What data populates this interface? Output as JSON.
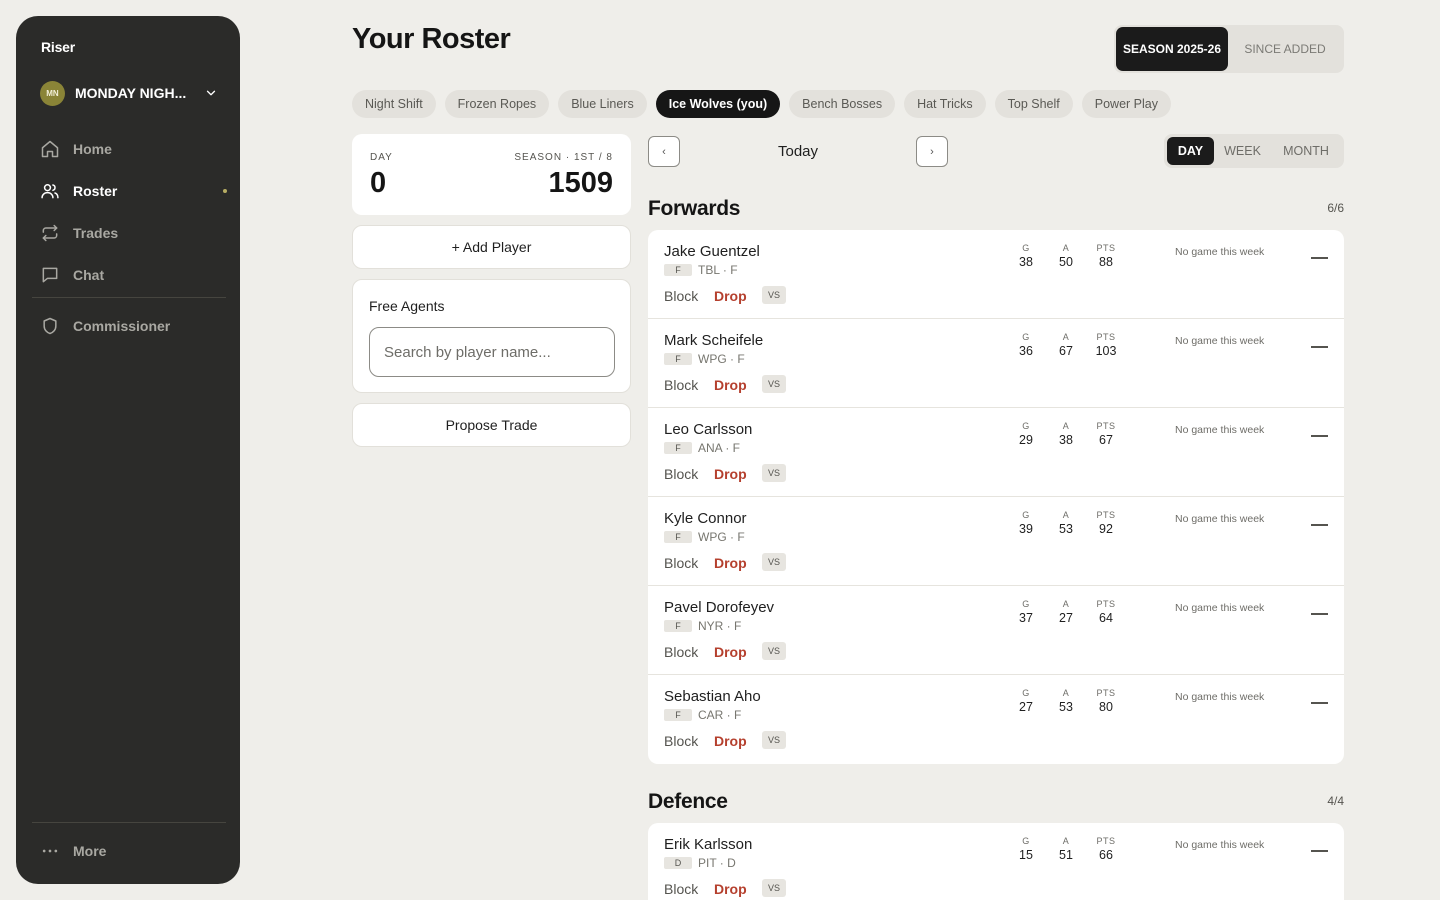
{
  "sidebar": {
    "brand": "Riser",
    "league": {
      "badge": "MN",
      "name": "MONDAY NIGH..."
    },
    "nav": [
      {
        "label": "Home",
        "icon": "home-icon",
        "active": false
      },
      {
        "label": "Roster",
        "icon": "users-icon",
        "active": true
      },
      {
        "label": "Trades",
        "icon": "swap-icon",
        "active": false
      },
      {
        "label": "Chat",
        "icon": "chat-icon",
        "active": false
      }
    ],
    "commissioner": {
      "label": "Commissioner",
      "icon": "shield-icon"
    },
    "more": {
      "label": "More",
      "icon": "ellipsis-icon"
    }
  },
  "header": {
    "title": "Your Roster",
    "season_toggle": {
      "active": "SEASON 2025-26",
      "inactive": "SINCE ADDED"
    }
  },
  "team_tabs": [
    {
      "label": "Night Shift",
      "active": false
    },
    {
      "label": "Frozen Ropes",
      "active": false
    },
    {
      "label": "Blue Liners",
      "active": false
    },
    {
      "label": "Ice Wolves (you)",
      "active": true
    },
    {
      "label": "Bench Bosses",
      "active": false
    },
    {
      "label": "Hat Tricks",
      "active": false
    },
    {
      "label": "Top Shelf",
      "active": false
    },
    {
      "label": "Power Play",
      "active": false
    }
  ],
  "day_card": {
    "day_label": "DAY",
    "day_value": "0",
    "season_label": "SEASON · 1ST / 8",
    "season_value": "1509"
  },
  "actions": {
    "add_player": "+ Add Player",
    "propose_trade": "Propose Trade"
  },
  "free_agents": {
    "title": "Free Agents",
    "placeholder": "Search by player name..."
  },
  "date_nav": {
    "prev": "‹",
    "label": "Today",
    "next": "›"
  },
  "range_toggle": [
    {
      "label": "DAY",
      "active": true
    },
    {
      "label": "WEEK",
      "active": false
    },
    {
      "label": "MONTH",
      "active": false
    }
  ],
  "stat_labels": {
    "g": "G",
    "a": "A",
    "pts": "PTS"
  },
  "row_actions": {
    "block": "Block",
    "drop": "Drop",
    "vs": "VS"
  },
  "sections": {
    "forwards": {
      "title": "Forwards",
      "count": "6/6",
      "players": [
        {
          "name": "Jake Guentzel",
          "pos": "F",
          "team": "TBL · F",
          "g": "38",
          "a": "50",
          "pts": "88",
          "game": "No game this week"
        },
        {
          "name": "Mark Scheifele",
          "pos": "F",
          "team": "WPG · F",
          "g": "36",
          "a": "67",
          "pts": "103",
          "game": "No game this week"
        },
        {
          "name": "Leo Carlsson",
          "pos": "F",
          "team": "ANA · F",
          "g": "29",
          "a": "38",
          "pts": "67",
          "game": "No game this week"
        },
        {
          "name": "Kyle Connor",
          "pos": "F",
          "team": "WPG · F",
          "g": "39",
          "a": "53",
          "pts": "92",
          "game": "No game this week"
        },
        {
          "name": "Pavel Dorofeyev",
          "pos": "F",
          "team": "NYR · F",
          "g": "37",
          "a": "27",
          "pts": "64",
          "game": "No game this week"
        },
        {
          "name": "Sebastian Aho",
          "pos": "F",
          "team": "CAR · F",
          "g": "27",
          "a": "53",
          "pts": "80",
          "game": "No game this week"
        }
      ]
    },
    "defence": {
      "title": "Defence",
      "count": "4/4",
      "players": [
        {
          "name": "Erik Karlsson",
          "pos": "D",
          "team": "PIT · D",
          "g": "15",
          "a": "51",
          "pts": "66",
          "game": "No game this week"
        }
      ]
    }
  }
}
